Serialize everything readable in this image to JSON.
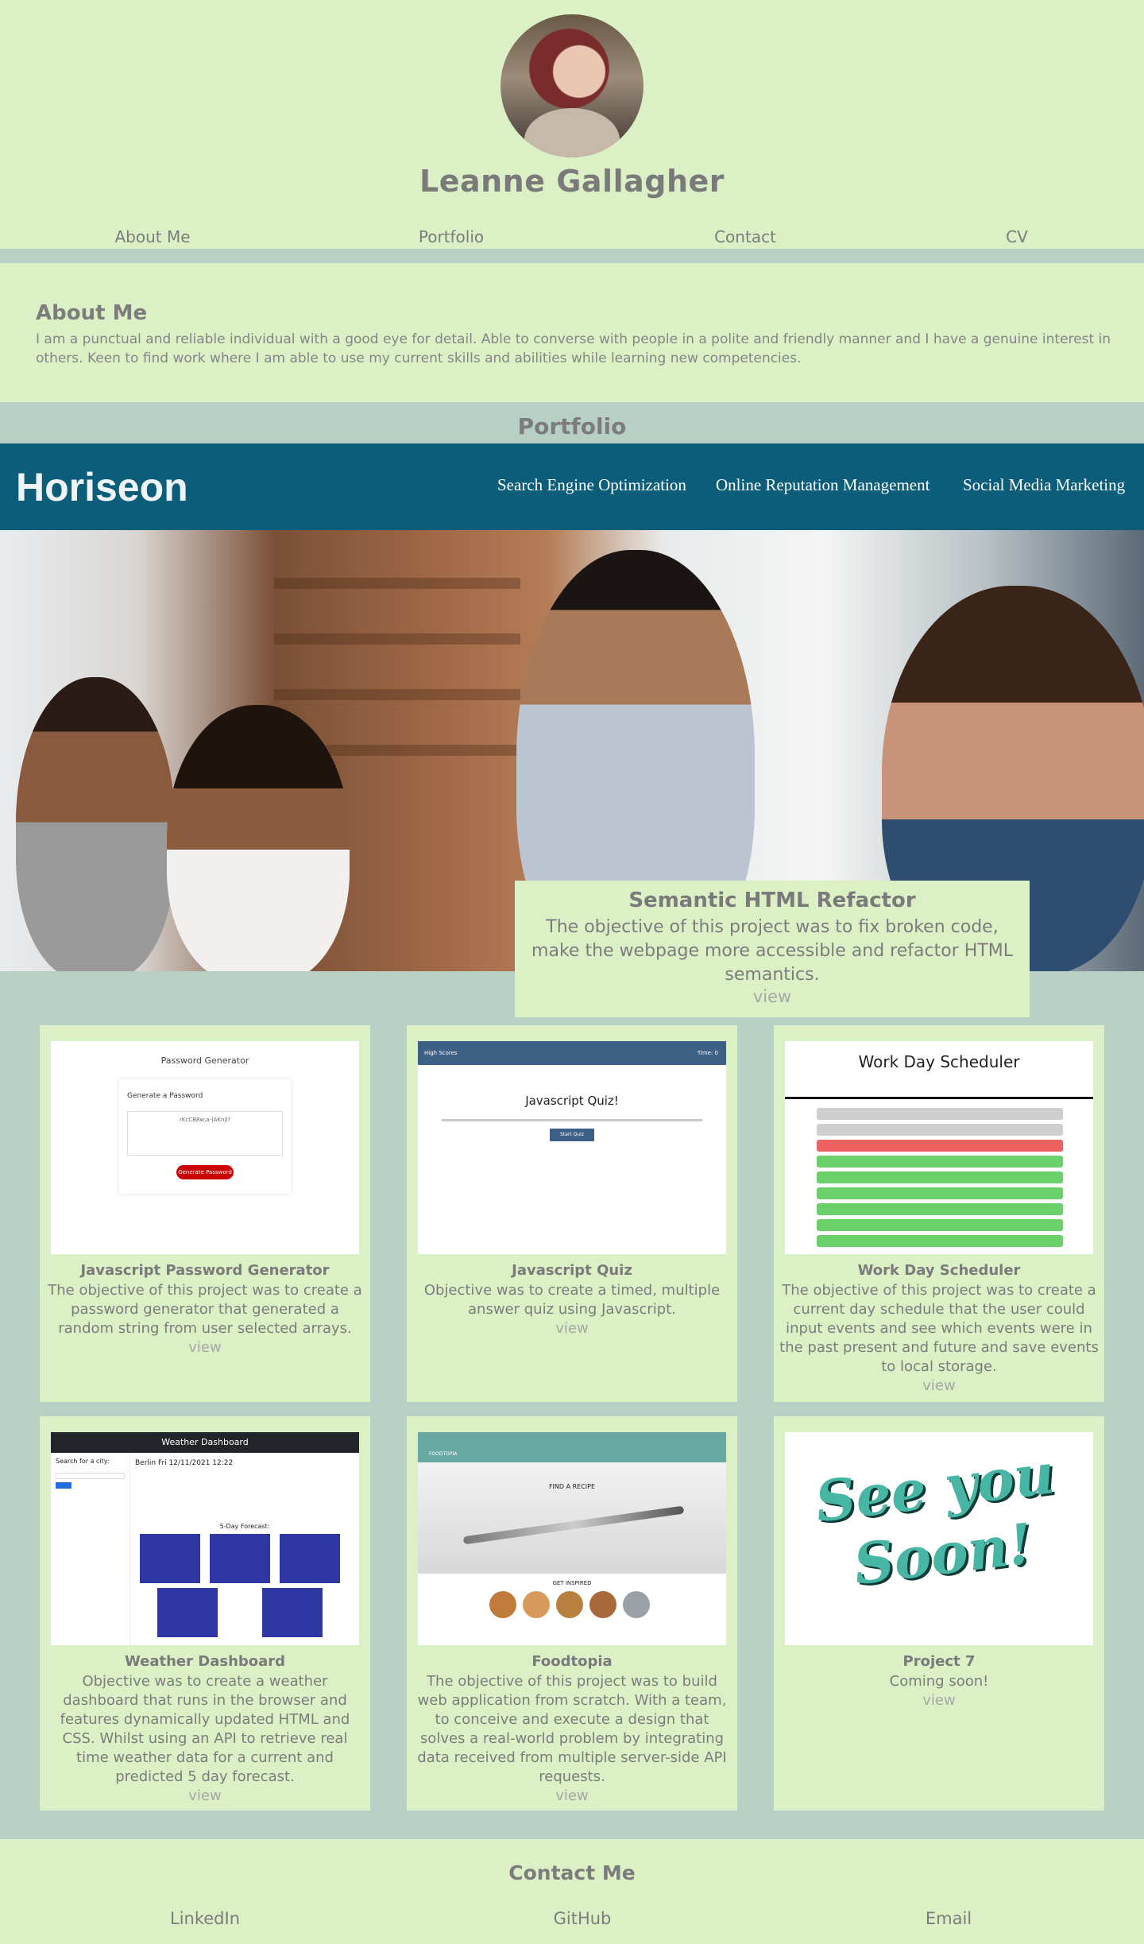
{
  "header": {
    "name": "Leanne Gallagher",
    "nav": [
      "About Me",
      "Portfolio",
      "Contact",
      "CV"
    ]
  },
  "about": {
    "title": "About Me",
    "text": "I am a punctual and reliable individual with a good eye for detail. Able to converse with people in a polite and friendly manner and I have a genuine interest in others. Keen to find work where I am able to use my current skills and abilities while learning new competencies."
  },
  "portfolio": {
    "title": "Portfolio",
    "featured": {
      "brand": "Horiseon",
      "brand_nav": [
        "Search Engine Optimization",
        "Online Reputation Management",
        "Social Media Marketing"
      ],
      "title": "Semantic HTML Refactor",
      "description": "The objective of this project was to fix broken code, make the webpage more accessible and refactor HTML semantics.",
      "link": "view"
    },
    "projects": [
      {
        "title": "Javascript Password Generator",
        "description": "The objective of this project was to create a password generator that generated a random string from user selected arrays.",
        "link": "view",
        "thumb": {
          "heading": "Password Generator",
          "panel": "Generate a Password",
          "value": "rKcCB8w;a-|AKnjl?",
          "button": "Generate Password"
        }
      },
      {
        "title": "Javascript Quiz",
        "description": "Objective was to create a timed, multiple answer quiz using Javascript.",
        "link": "view",
        "thumb": {
          "left": "High Scores",
          "right": "Time: 0",
          "heading": "Javascript Quiz!",
          "button": "Start Quiz"
        }
      },
      {
        "title": "Work Day Scheduler",
        "description": "The objective of this project was to create a current day schedule that the user could input events and see which events were in the past present and future and save events to local storage.",
        "link": "view",
        "thumb": {
          "heading": "Work Day Scheduler"
        }
      },
      {
        "title": "Weather Dashboard",
        "description": "Objective was to create a weather dashboard that runs in the browser and features dynamically updated HTML and CSS. Whilst using an API to retrieve real time weather data for a current and predicted 5 day forecast.",
        "link": "view",
        "thumb": {
          "bar": "Weather Dashboard",
          "search": "Search for a city:",
          "city": "Berlin Fri 12/11/2021 12:22",
          "forecast": "5-Day Forecast:"
        }
      },
      {
        "title": "Foodtopia",
        "description": "The objective of this project was to build web application from scratch. With a team, to conceive and execute a design that solves a real-world problem by integrating data received from multiple server-side API requests.",
        "link": "view",
        "thumb": {
          "brand": "FOODTOPIA",
          "find": "FIND A RECIPE",
          "inspired": "GET INSPIRED"
        }
      },
      {
        "title": "Project 7",
        "description": "Coming soon!",
        "link": "view",
        "thumb": {
          "text": "See you Soon!"
        }
      }
    ]
  },
  "contact": {
    "title": "Contact Me",
    "links": [
      "LinkedIn",
      "GitHub",
      "Email"
    ]
  },
  "colors": {
    "background": "#dcf0c5",
    "band": "#b8cfc6",
    "horiseon": "#0b5d7a",
    "text": "#7c7c7c"
  }
}
